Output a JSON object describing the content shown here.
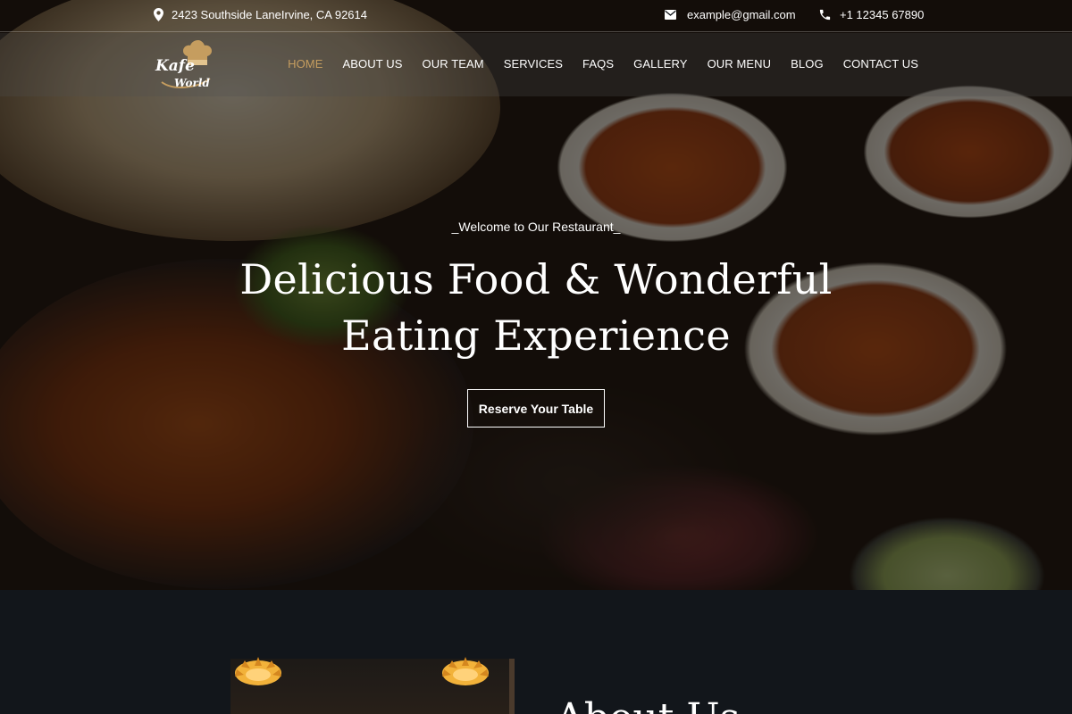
{
  "topbar": {
    "address": "2423 Southside LaneIrvine, CA 92614",
    "email": "example@gmail.com",
    "phone": "+1 12345 67890",
    "icons": [
      "map-pin-icon",
      "envelope-icon",
      "phone-icon"
    ]
  },
  "header": {
    "logo_line1": "Kafe",
    "logo_line2": "World",
    "nav": [
      "HOME",
      "ABOUT US",
      "OUR TEAM",
      "SERVICES",
      "FAQS",
      "GALLERY",
      "OUR MENU",
      "BLOG",
      "CONTACT US"
    ],
    "active_nav": "HOME"
  },
  "hero": {
    "tagline": "_Welcome to Our Restaurant_",
    "headline_line1": "Delicious Food & Wonderful",
    "headline_line2": "Eating Experience",
    "cta": "Reserve Your Table"
  },
  "about": {
    "title": "About Us"
  },
  "colors": {
    "accent": "#c59d5f",
    "dark_bg": "#12161b",
    "text": "#ffffff"
  }
}
